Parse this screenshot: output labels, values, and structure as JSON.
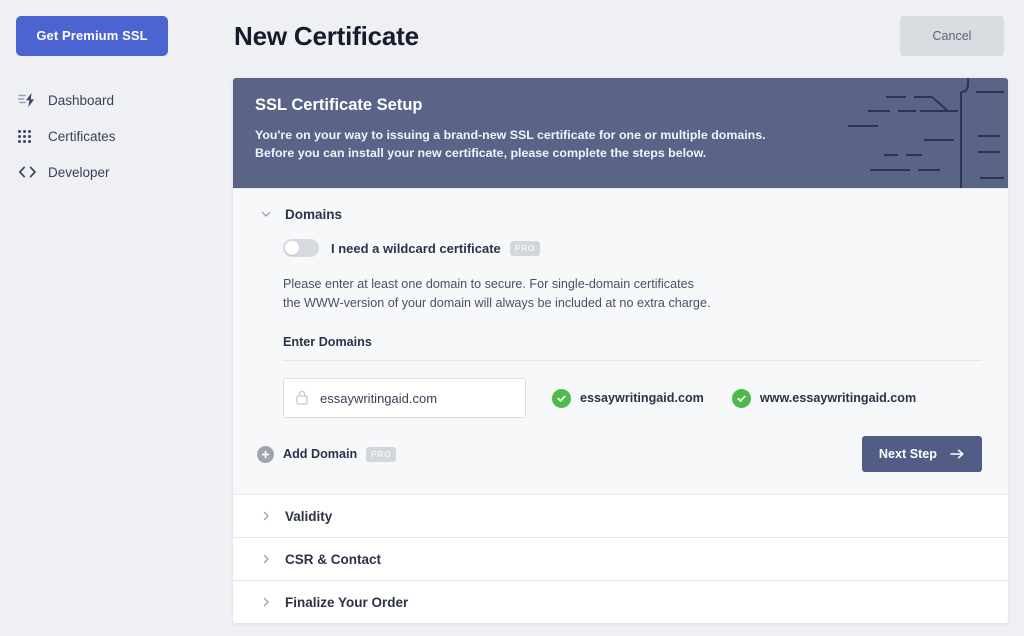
{
  "sidebar": {
    "premium_button": "Get Premium SSL",
    "items": [
      {
        "label": "Dashboard",
        "icon": "lightning-bolt-icon"
      },
      {
        "label": "Certificates",
        "icon": "grid-dots-icon"
      },
      {
        "label": "Developer",
        "icon": "code-brackets-icon"
      }
    ]
  },
  "header": {
    "title": "New Certificate",
    "cancel_label": "Cancel"
  },
  "banner": {
    "title": "SSL Certificate Setup",
    "line1": "You're on your way to issuing a brand-new SSL certificate for one or multiple domains.",
    "line2": "Before you can install your new certificate, please complete the steps below.",
    "background_color": "#5a6488"
  },
  "domains_section": {
    "title": "Domains",
    "chevron": "chevron-down-icon",
    "wildcard_toggle": {
      "label": "I need a wildcard certificate",
      "badge": "PRO",
      "checked": false
    },
    "help_line1": "Please enter at least one domain to secure. For single-domain certificates",
    "help_line2": "the WWW-version of your domain will always be included at no extra charge.",
    "field_label": "Enter Domains",
    "domain_input": {
      "value": "essaywritingaid.com",
      "placeholder": "essaywritingaid.com",
      "icon": "lock-icon"
    },
    "verified_domains": [
      {
        "name": "essaywritingaid.com",
        "status": "valid"
      },
      {
        "name": "www.essaywritingaid.com",
        "status": "valid"
      }
    ],
    "add_domain": {
      "label": "Add Domain",
      "badge": "PRO",
      "icon": "plus-circle-icon"
    },
    "next_button": {
      "label": "Next Step",
      "icon": "arrow-right-icon"
    }
  },
  "collapsed_sections": [
    {
      "title": "Validity",
      "chevron": "chevron-right-icon"
    },
    {
      "title": "CSR & Contact",
      "chevron": "chevron-right-icon"
    },
    {
      "title": "Finalize Your Order",
      "chevron": "chevron-right-icon"
    }
  ],
  "colors": {
    "accent_blue": "#4c63d2",
    "banner_slate": "#5a6488",
    "success_green": "#4cbb4c",
    "page_background": "#eef0f4"
  }
}
